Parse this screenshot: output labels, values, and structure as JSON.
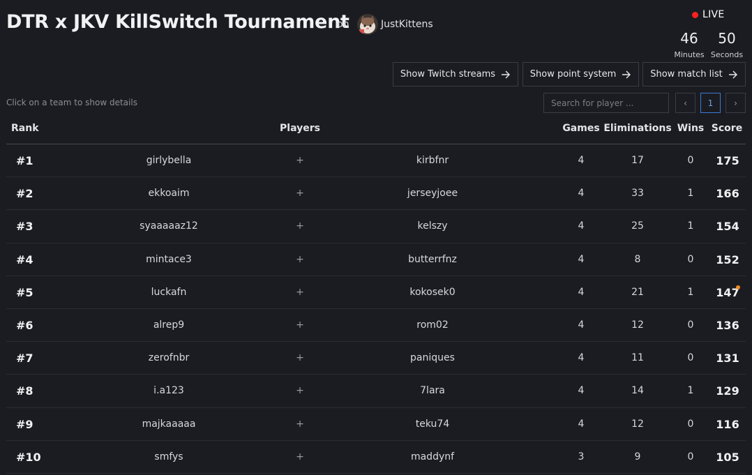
{
  "header": {
    "title": "DTR x JKV KillSwitch Tournament",
    "on_label": "on",
    "streamer_name": "JustKittens",
    "live_label": "LIVE",
    "timer": {
      "minutes_value": "46",
      "minutes_label": "Minutes",
      "seconds_value": "50",
      "seconds_label": "Seconds"
    }
  },
  "actions": {
    "twitch_label": "Show Twitch streams",
    "points_label": "Show point system",
    "matches_label": "Show match list"
  },
  "hint": "Click on a team to show details",
  "search": {
    "placeholder": "Search for player ..."
  },
  "pagination": {
    "prev": "‹",
    "current": "1",
    "next": "›"
  },
  "table": {
    "columns": {
      "rank": "Rank",
      "players": "Players",
      "games": "Games",
      "eliminations": "Eliminations",
      "wins": "Wins",
      "score": "Score"
    },
    "separator": "+",
    "rows": [
      {
        "rank": "#1",
        "player1": "girlybella",
        "player2": "kirbfnr",
        "games": "4",
        "elims": "17",
        "wins": "0",
        "score": "175"
      },
      {
        "rank": "#2",
        "player1": "ekkoaim",
        "player2": "jerseyjoee",
        "games": "4",
        "elims": "33",
        "wins": "1",
        "score": "166"
      },
      {
        "rank": "#3",
        "player1": "syaaaaaz12",
        "player2": "kelszy",
        "games": "4",
        "elims": "25",
        "wins": "1",
        "score": "154"
      },
      {
        "rank": "#4",
        "player1": "mintace3",
        "player2": "butterrfnz",
        "games": "4",
        "elims": "8",
        "wins": "0",
        "score": "152"
      },
      {
        "rank": "#5",
        "player1": "luckafn",
        "player2": "kokosek0",
        "games": "4",
        "elims": "21",
        "wins": "1",
        "score": "147"
      },
      {
        "rank": "#6",
        "player1": "alrep9",
        "player2": "rom02",
        "games": "4",
        "elims": "12",
        "wins": "0",
        "score": "136"
      },
      {
        "rank": "#7",
        "player1": "zerofnbr",
        "player2": "paniques",
        "games": "4",
        "elims": "11",
        "wins": "0",
        "score": "131"
      },
      {
        "rank": "#8",
        "player1": "i.a123",
        "player2": "7lara",
        "games": "4",
        "elims": "14",
        "wins": "1",
        "score": "129"
      },
      {
        "rank": "#9",
        "player1": "majkaaaaa",
        "player2": "teku74",
        "games": "4",
        "elims": "12",
        "wins": "0",
        "score": "116"
      },
      {
        "rank": "#10",
        "player1": "smfys",
        "player2": "maddynf",
        "games": "3",
        "elims": "9",
        "wins": "0",
        "score": "105"
      }
    ]
  },
  "colors": {
    "background": "#1b1c21",
    "live": "#ff2020",
    "page_active": "#3a7bd5",
    "notification": "#f08a24"
  }
}
